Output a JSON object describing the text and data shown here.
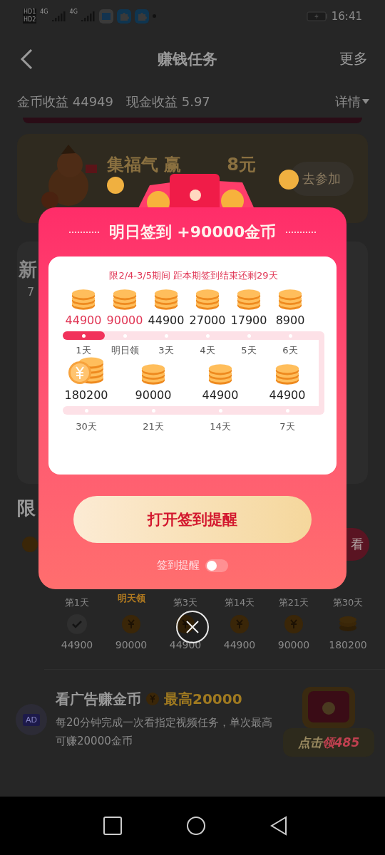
{
  "status_bar": {
    "sim_labels": [
      "HD1",
      "HD2"
    ],
    "network": [
      "4G",
      "4G"
    ],
    "time": "16:41"
  },
  "nav": {
    "title": "赚钱任务",
    "action": "更多"
  },
  "earnings": {
    "coins": "金币收益 44949",
    "cash": "现金收益 5.97",
    "details": "详情"
  },
  "banner": {
    "title": "集福气 赢",
    "title_tail": "8元",
    "button": "去参加"
  },
  "task_card": {
    "heading_fragment": "新",
    "line_fragment": "7"
  },
  "section_heading": "限",
  "limited_row": {
    "button_fragment": "看"
  },
  "checkin_strip": [
    {
      "label": "第1天",
      "value": "44900",
      "kind": "check",
      "highlight": false
    },
    {
      "label": "明天领",
      "value": "90000",
      "kind": "coin",
      "highlight": true
    },
    {
      "label": "第3天",
      "value": "44900",
      "kind": "coin",
      "highlight": false
    },
    {
      "label": "第14天",
      "value": "44900",
      "kind": "coin",
      "highlight": false
    },
    {
      "label": "第21天",
      "value": "90000",
      "kind": "coin",
      "highlight": false
    },
    {
      "label": "第30天",
      "value": "180200",
      "kind": "stack",
      "highlight": false
    }
  ],
  "ad_task": {
    "badge": "AD",
    "title": "看广告赚金币",
    "max": "最高20000",
    "description": "每20分钟完成一次看指定视频任务，单次最高可赚20000金币",
    "button_prefix": "点击",
    "button_reward": "领485"
  },
  "modal": {
    "title": "明日签到 +90000金币",
    "period": "限2/4-3/5期间 距本期签到结束还剩29天",
    "progress": {
      "level": 0.16
    },
    "days_row1": [
      {
        "amount": "44900",
        "label": "1天",
        "highlight": true
      },
      {
        "amount": "90000",
        "label": "明日领",
        "highlight": true
      },
      {
        "amount": "44900",
        "label": "3天",
        "highlight": false
      },
      {
        "amount": "27000",
        "label": "4天",
        "highlight": false
      },
      {
        "amount": "17900",
        "label": "5天",
        "highlight": false
      },
      {
        "amount": "8900",
        "label": "6天",
        "highlight": false
      }
    ],
    "days_row2": [
      {
        "amount": "180200",
        "label": "30天",
        "kind": "big"
      },
      {
        "amount": "90000",
        "label": "21天",
        "kind": "stack"
      },
      {
        "amount": "44900",
        "label": "14天",
        "kind": "stack"
      },
      {
        "amount": "44900",
        "label": "7天",
        "kind": "stack"
      }
    ],
    "button": "打开签到提醒",
    "reminder": {
      "label": "签到提醒",
      "on": false
    }
  }
}
